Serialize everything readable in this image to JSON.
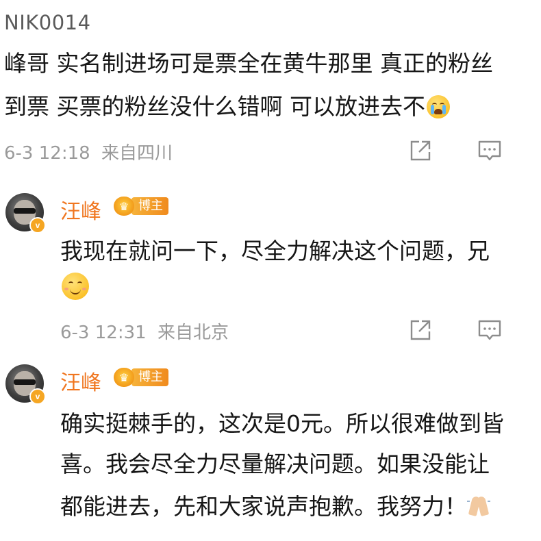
{
  "first_comment": {
    "username": "NIK0014",
    "line1": "峰哥 实名制进场可是票全在黄牛那里 真正的粉丝",
    "line2": "到票 买票的粉丝没什么错啊 可以放进去不",
    "line2_emoji": "crying-face-emoji",
    "timestamp": "6-3 12:18",
    "location": "来自四川"
  },
  "reply1": {
    "author": "汪峰",
    "badge_label": "博主",
    "line1": "我现在就问一下，尽全力解决这个问题，兄",
    "line2_emoji": "smiling-face-emoji",
    "timestamp": "6-3 12:31",
    "location": "来自北京"
  },
  "reply2": {
    "author": "汪峰",
    "badge_label": "博主",
    "line1": "确实挺棘手的，这次是0元。所以很难做到皆",
    "line2": "喜。我会尽全力尽量解决问题。如果没能让",
    "line3": "都能进去，先和大家说声抱歉。我努力！",
    "line3_emoji": "folded-hands-emoji"
  },
  "icons": {
    "share": "share-icon",
    "comment": "comment-icon",
    "verified": "verified-v-icon",
    "crown": "crown-icon"
  },
  "colors": {
    "author": "#f0761f",
    "badge": "#f6a42c",
    "meta": "#9a9a9a",
    "text": "#161616"
  }
}
